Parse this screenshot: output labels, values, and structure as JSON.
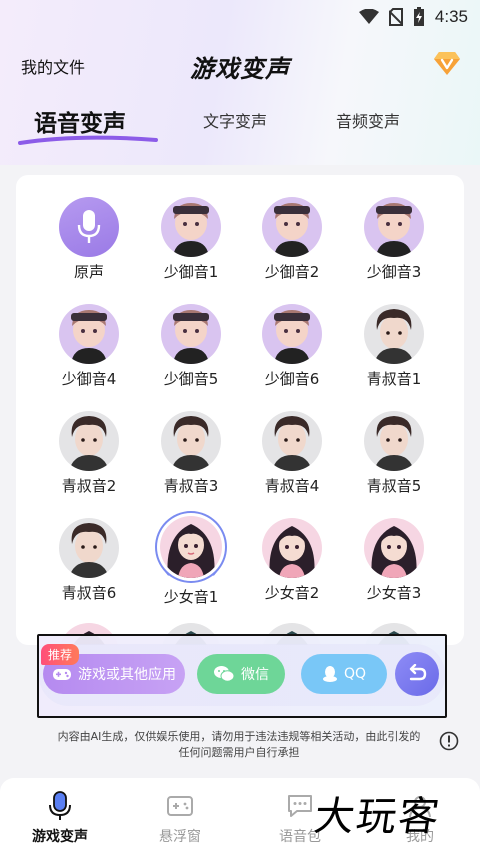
{
  "status_bar": {
    "time": "4:35",
    "icons": [
      "wifi-icon",
      "no-sim-icon",
      "battery-charging-icon"
    ]
  },
  "header": {
    "left_link": "我的文件",
    "title": "游戏变声",
    "vip_icon": "diamond-v-icon"
  },
  "tabs": [
    {
      "label": "语音变声",
      "active": true
    },
    {
      "label": "文字变声",
      "active": false
    },
    {
      "label": "音频变声",
      "active": false
    }
  ],
  "voices": [
    {
      "label": "原声",
      "style": "mic"
    },
    {
      "label": "少御音1",
      "style": "purple"
    },
    {
      "label": "少御音2",
      "style": "purple"
    },
    {
      "label": "少御音3",
      "style": "purple"
    },
    {
      "label": "少御音4",
      "style": "purple"
    },
    {
      "label": "少御音5",
      "style": "purple"
    },
    {
      "label": "少御音6",
      "style": "purple"
    },
    {
      "label": "青叔音1",
      "style": "grey"
    },
    {
      "label": "青叔音2",
      "style": "grey"
    },
    {
      "label": "青叔音3",
      "style": "grey"
    },
    {
      "label": "青叔音4",
      "style": "grey"
    },
    {
      "label": "青叔音5",
      "style": "grey"
    },
    {
      "label": "青叔音6",
      "style": "grey"
    },
    {
      "label": "少女音1",
      "style": "pink",
      "selected": true
    },
    {
      "label": "少女音2",
      "style": "pink"
    },
    {
      "label": "少女音3",
      "style": "pink"
    }
  ],
  "share_bar": {
    "badge": "推荐",
    "game_label": "游戏或其他应用",
    "wechat_label": "微信",
    "qq_label": "QQ"
  },
  "disclaimer": "内容由AI生成，仅供娱乐使用，请勿用于违法违规等相关活动，由此引发的任何问题需用户自行承担",
  "bottom_nav": [
    {
      "label": "游戏变声",
      "icon": "mic-icon",
      "active": true
    },
    {
      "label": "悬浮窗",
      "icon": "gamepad-window-icon",
      "active": false
    },
    {
      "label": "语音包",
      "icon": "chat-bubble-icon",
      "active": false
    },
    {
      "label": "我的",
      "icon": "profile-icon",
      "active": false
    }
  ],
  "watermark": "大玩客",
  "colors": {
    "accent_purple": "#9a7ae6",
    "wechat_green": "#6ed698",
    "qq_blue": "#79c7f7",
    "badge_red": "#ff4f7a"
  }
}
